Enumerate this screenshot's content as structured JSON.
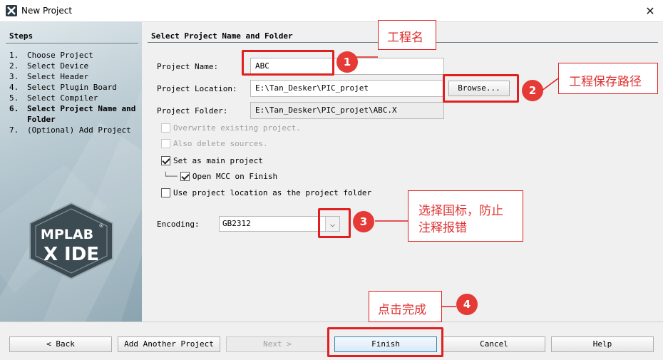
{
  "window": {
    "title": "New Project",
    "close_glyph": "✕",
    "app_icon": "mplab-x-icon"
  },
  "sidebar": {
    "title": "Steps",
    "steps": [
      {
        "num": "1.",
        "label": "Choose Project"
      },
      {
        "num": "2.",
        "label": "Select Device"
      },
      {
        "num": "3.",
        "label": "Select Header"
      },
      {
        "num": "4.",
        "label": "Select Plugin Board"
      },
      {
        "num": "5.",
        "label": "Select Compiler"
      },
      {
        "num": "6.",
        "label": "Select Project Name and Folder"
      },
      {
        "num": "7.",
        "label": "(Optional) Add Project"
      }
    ],
    "current_step": 6,
    "logo_top": "MPLAB",
    "logo_reg": "®",
    "logo_bottom": "X IDE"
  },
  "main": {
    "title": "Select Project Name and Folder",
    "project_name": {
      "label": "Project Name:",
      "value": "ABC"
    },
    "project_location": {
      "label": "Project Location:",
      "value": "E:\\Tan_Desker\\PIC_projet"
    },
    "browse_label": "Browse...",
    "project_folder": {
      "label": "Project Folder:",
      "value": "E:\\Tan_Desker\\PIC_projet\\ABC.X"
    },
    "overwrite": {
      "label": "Overwrite existing project.",
      "checked": false,
      "enabled": false
    },
    "delete_sources": {
      "label": "Also delete sources.",
      "checked": false,
      "enabled": false
    },
    "main_project": {
      "label": "Set as main project",
      "checked": true
    },
    "open_mcc": {
      "label": "Open MCC on Finish",
      "checked": true,
      "connector": "└──"
    },
    "use_location": {
      "label": "Use project location as the project folder",
      "checked": false
    },
    "encoding": {
      "label": "Encoding:",
      "value": "GB2312",
      "arrow": "⌵"
    }
  },
  "footer": {
    "back": "< Back",
    "add_another": "Add Another Project",
    "next": "Next >",
    "finish": "Finish",
    "cancel": "Cancel",
    "help": "Help"
  },
  "annotations": {
    "callout_1": "工程名",
    "callout_2": "工程保存路径",
    "callout_3_line1": "选择国标，防止",
    "callout_3_line2": "注释报错",
    "callout_4": "点击完成",
    "badge_1": "1",
    "badge_2": "2",
    "badge_3": "3",
    "badge_4": "4",
    "color": "#e02020"
  }
}
